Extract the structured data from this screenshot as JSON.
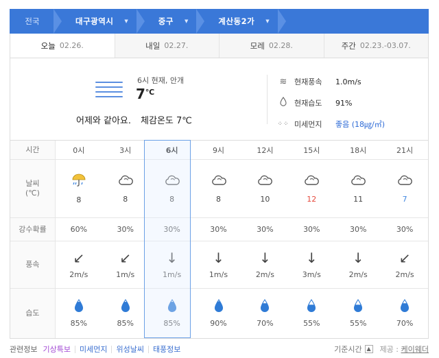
{
  "breadcrumb": {
    "root": "전국",
    "levels": [
      "대구광역시",
      "중구",
      "계산동2가"
    ]
  },
  "tabs": [
    {
      "label": "오늘",
      "date": "02.26.",
      "active": true
    },
    {
      "label": "내일",
      "date": "02.27.",
      "active": false
    },
    {
      "label": "모레",
      "date": "02.28.",
      "active": false
    },
    {
      "label": "주간",
      "date": "02.23.-03.07.",
      "active": false
    }
  ],
  "current": {
    "observation": "6시 현재, 안개",
    "temp": "7",
    "temp_unit": "℃",
    "comparison": "어제와 같아요.",
    "feels_like": "체감온도 7℃",
    "icon": "fog-icon",
    "wind_label": "현재풍속",
    "wind_value": "1.0m/s",
    "humidity_label": "현재습도",
    "humidity_value": "91%",
    "dust_label": "미세먼지",
    "dust_value": "좋음 (18㎍/㎥)"
  },
  "forecast": {
    "row_labels": {
      "time": "시간",
      "weather": "날씨",
      "weather_unit": "(℃)",
      "rain": "강수확률",
      "wind": "풍속",
      "humidity": "습도"
    },
    "selected_index": 2,
    "slots": [
      {
        "time": "0시",
        "icon": "umbrella-rain-icon",
        "temp": "8",
        "rain": "60%",
        "wind_dir": "↙",
        "wind": "2m/s",
        "humidity": "85%"
      },
      {
        "time": "3시",
        "icon": "cloud-icon",
        "temp": "8",
        "rain": "30%",
        "wind_dir": "↙",
        "wind": "1m/s",
        "humidity": "85%"
      },
      {
        "time": "6시",
        "icon": "cloud-icon",
        "temp": "8",
        "rain": "30%",
        "wind_dir": "↓",
        "wind": "1m/s",
        "humidity": "85%"
      },
      {
        "time": "9시",
        "icon": "cloud-icon",
        "temp": "8",
        "rain": "30%",
        "wind_dir": "↓",
        "wind": "1m/s",
        "humidity": "90%"
      },
      {
        "time": "12시",
        "icon": "cloud-icon",
        "temp": "10",
        "rain": "30%",
        "wind_dir": "↓",
        "wind": "2m/s",
        "humidity": "70%"
      },
      {
        "time": "15시",
        "icon": "cloud-icon",
        "temp": "12",
        "rain": "30%",
        "wind_dir": "↓",
        "wind": "3m/s",
        "humidity": "55%",
        "temp_color": "#e5483b"
      },
      {
        "time": "18시",
        "icon": "cloud-icon",
        "temp": "11",
        "rain": "30%",
        "wind_dir": "↓",
        "wind": "2m/s",
        "humidity": "55%"
      },
      {
        "time": "21시",
        "icon": "cloud-icon",
        "temp": "7",
        "rain": "30%",
        "wind_dir": "↙",
        "wind": "2m/s",
        "humidity": "70%",
        "temp_color": "#3f86e0"
      }
    ]
  },
  "footer": {
    "lead": "관련정보",
    "links": [
      "기상특보",
      "미세먼지",
      "위성날씨",
      "태풍정보"
    ],
    "basis": "기준시간",
    "provider_label": "제공 :",
    "provider": "케이웨더"
  },
  "colors": {
    "accent": "#3a78d8",
    "hot": "#e5483b",
    "cold": "#3f86e0",
    "highlight_border": "#6ba0e6"
  }
}
